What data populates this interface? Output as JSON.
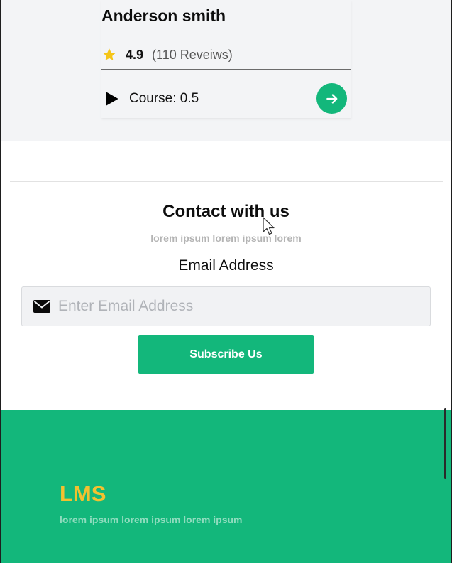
{
  "card": {
    "name": "Anderson smith",
    "rating": "4.9",
    "reviews": "(110 Reveiws)",
    "course": "Course: 0.5",
    "star_icon": "star-icon",
    "play_icon": "play-icon",
    "go_icon": "arrow-right-icon"
  },
  "contact": {
    "title": "Contact with us",
    "subtitle": "lorem ipsum lorem ipsum lorem",
    "email_label": "Email Address",
    "email_placeholder": "Enter Email Address",
    "email_value": "",
    "mail_icon": "envelope-icon",
    "subscribe_label": "Subscribe Us"
  },
  "footer": {
    "logo": "LMS",
    "subtitle": "lorem ipsum lorem ipsum lorem ipsum"
  },
  "colors": {
    "accent": "#13b77b",
    "logo": "#f3c12f",
    "star": "#f5c518",
    "top_background": "#f3f4f6"
  }
}
